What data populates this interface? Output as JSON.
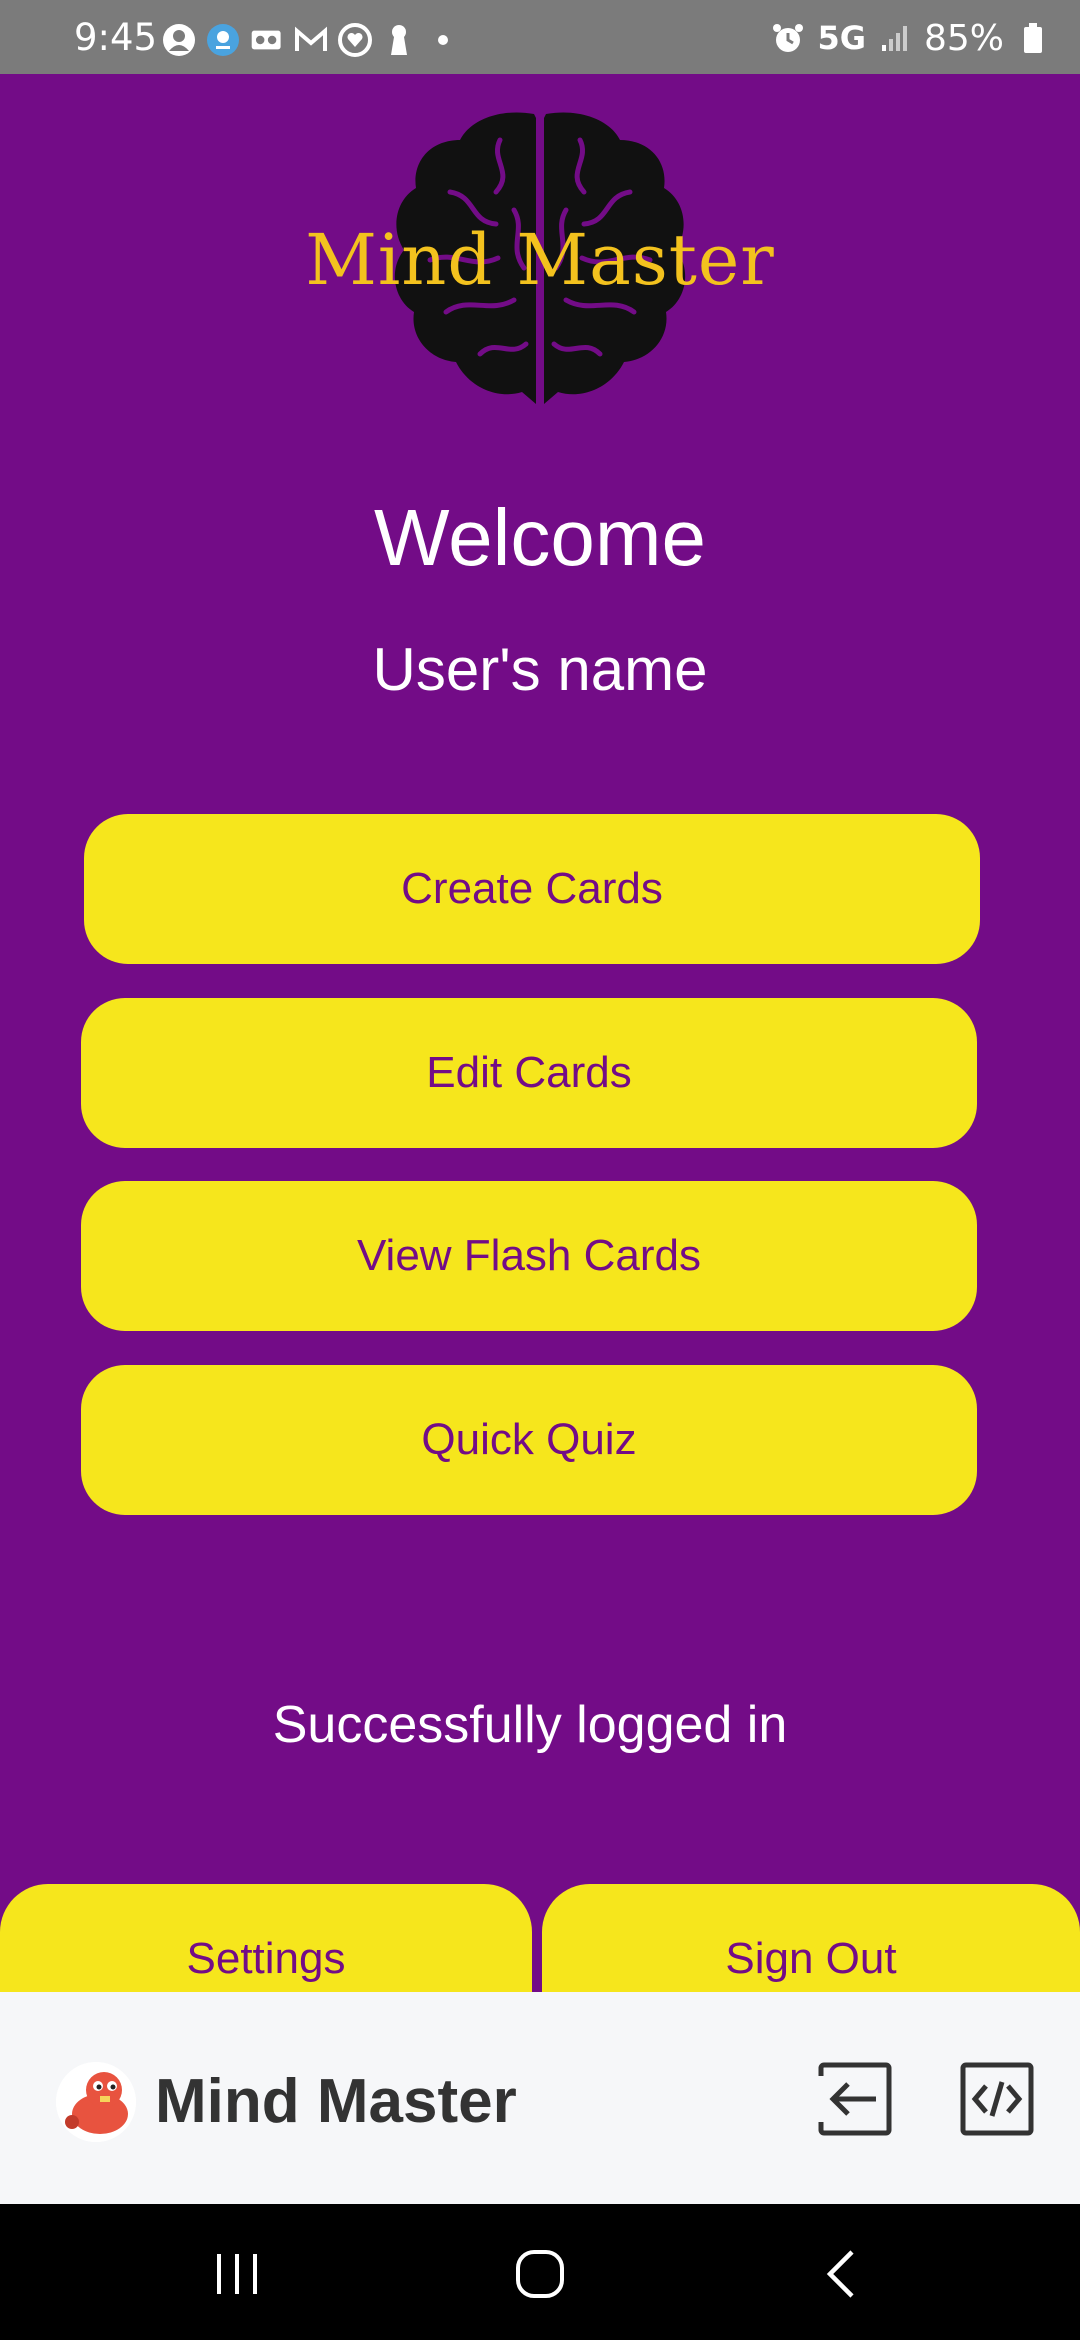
{
  "status_bar": {
    "time": "9:45",
    "network": "5G",
    "battery": "85%"
  },
  "logo": {
    "title": "Mind Master",
    "icon": "brain-icon",
    "colors": {
      "title": "#f3c21e",
      "brain": "#111111"
    }
  },
  "welcome": "Welcome",
  "username": "User's name",
  "menu": {
    "create": "Create Cards",
    "edit": "Edit Cards",
    "view": "View Flash Cards",
    "quiz": "Quick Quiz"
  },
  "status_message": "Successfully logged in",
  "bottom": {
    "settings": "Settings",
    "signout": "Sign Out"
  },
  "app_bar": {
    "name": "Mind Master",
    "exit_icon": "exit-icon",
    "code_icon": "code-icon"
  },
  "colors": {
    "background": "#730c87",
    "button": "#f6e61c",
    "button_text": "#730c87",
    "status_bar": "#7b7b7b",
    "app_bar": "#f6f7f9"
  }
}
